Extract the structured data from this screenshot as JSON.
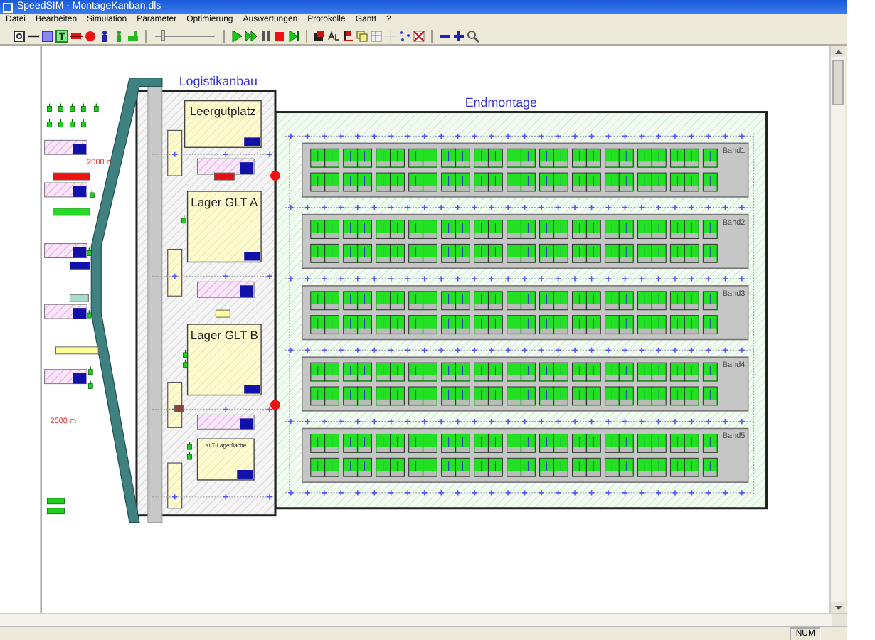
{
  "window": {
    "title": "SpeedSIM - MontageKanban.dls"
  },
  "menu": [
    "Datei",
    "Bearbeiten",
    "Simulation",
    "Parameter",
    "Optimierung",
    "Auswertungen",
    "Protokolle",
    "Gantt",
    "?"
  ],
  "toolbar": {
    "speed_slider": {
      "level": 0.15
    }
  },
  "canvas": {
    "logistics_area": {
      "title": "Logistikanbau",
      "storages": [
        {
          "label": "Leergutplatz"
        },
        {
          "label": "Lager GLT A"
        },
        {
          "label": "Lager GLT B"
        },
        {
          "label": "KLT-Lagerfläche"
        }
      ]
    },
    "assembly_area": {
      "title": "Endmontage",
      "bands": [
        {
          "label": "Band1"
        },
        {
          "label": "Band2"
        },
        {
          "label": "Band3"
        },
        {
          "label": "Band4"
        },
        {
          "label": "Band5"
        }
      ]
    },
    "distance_labels": [
      "2000 m",
      "2000 m"
    ]
  },
  "status_bar": {
    "indicator": "NUM"
  }
}
